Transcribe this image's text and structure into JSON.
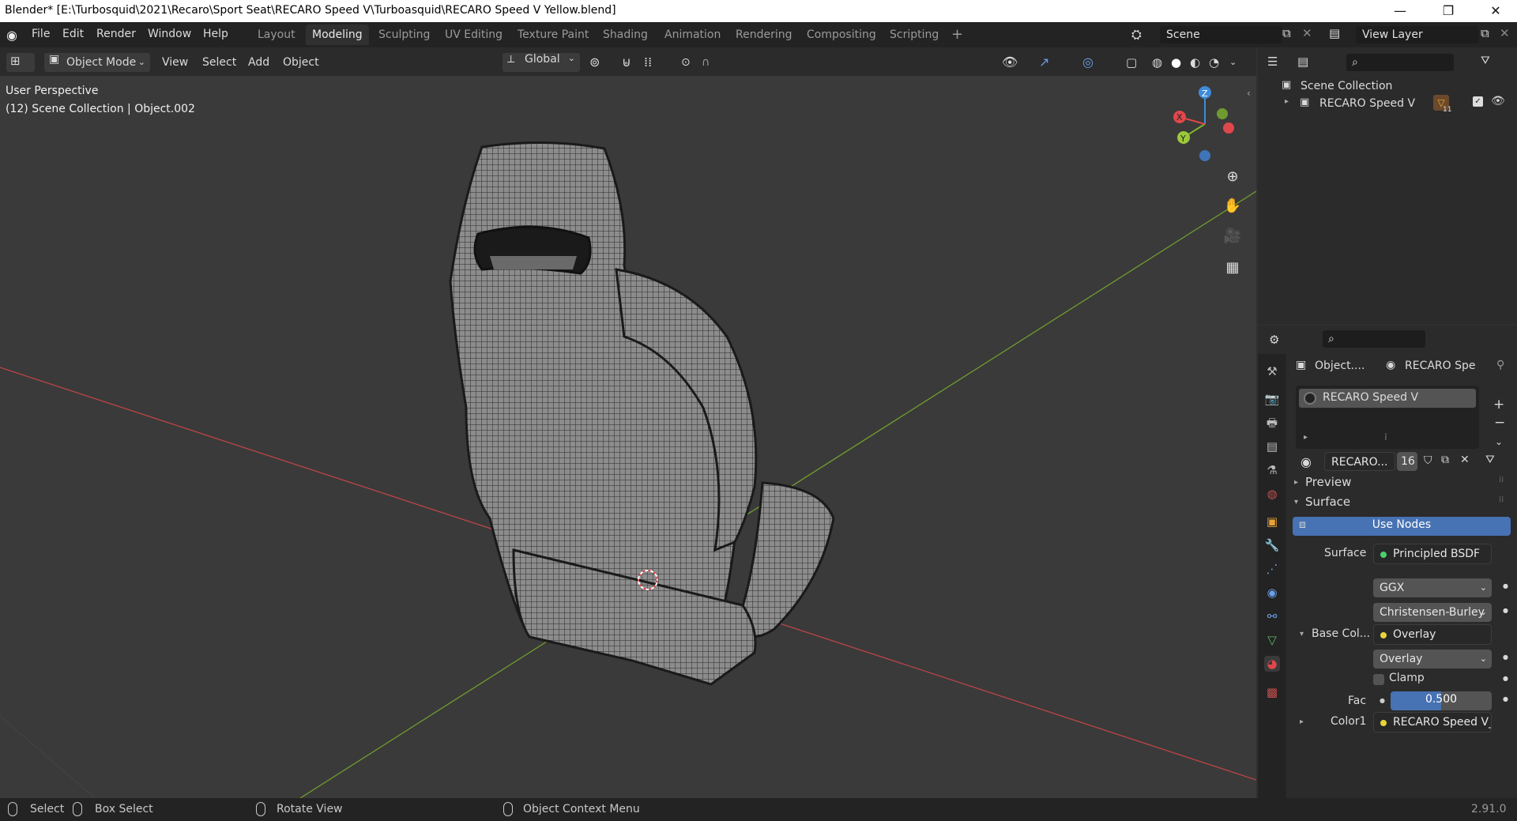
{
  "window": {
    "title": "Blender* [E:\\Turbosquid\\2021\\Recaro\\Sport Seat\\RECARO Speed V\\Turboasquid\\RECARO Speed V Yellow.blend]",
    "minimize": "—",
    "maximize": "❐",
    "close": "✕"
  },
  "menu": [
    "File",
    "Edit",
    "Render",
    "Window",
    "Help"
  ],
  "workspaces": [
    "Layout",
    "Modeling",
    "Sculpting",
    "UV Editing",
    "Texture Paint",
    "Shading",
    "Animation",
    "Rendering",
    "Compositing",
    "Scripting"
  ],
  "active_workspace": "Modeling",
  "add_workspace": "+",
  "scene": {
    "name": "Scene",
    "view_layer": "View Layer"
  },
  "viewport_header": {
    "mode": "Object Mode",
    "menus": [
      "View",
      "Select",
      "Add",
      "Object"
    ],
    "orientation": "Global"
  },
  "viewport": {
    "perspective": "User Perspective",
    "collection_info": "(12) Scene Collection | Object.002",
    "gizmo": {
      "x": "X",
      "y": "Y",
      "z": "Z"
    },
    "colors": {
      "x_axis": "#e0474b",
      "y_axis": "#7fb52a",
      "z_axis": "#3f8bd8",
      "background": "#3a3a3a"
    }
  },
  "outliner": {
    "root": "Scene Collection",
    "items": [
      {
        "label": "RECARO Speed V",
        "count": "11"
      }
    ]
  },
  "properties": {
    "breadcrumb_object": "Object....",
    "breadcrumb_material": "RECARO Spe",
    "material_slot": "RECARO Speed V",
    "material_name": "RECARO...",
    "users": "16",
    "sections": {
      "preview": "Preview",
      "surface": "Surface"
    },
    "use_nodes": "Use Nodes",
    "surface_label": "Surface",
    "surface_shader": "Principled BSDF",
    "distribution": "GGX",
    "subsurface": "Christensen-Burley",
    "base_color_label": "Base Col...",
    "base_color_node": "Overlay",
    "blend_mode": "Overlay",
    "clamp": "Clamp",
    "fac_label": "Fac",
    "fac_value": "0.500",
    "fac": 0.5,
    "color1_label": "Color1",
    "color1_value": "RECARO Speed V_...",
    "accent": "#4772b3"
  },
  "status": {
    "select": "Select",
    "box_select": "Box Select",
    "rotate": "Rotate View",
    "context": "Object Context Menu",
    "version": "2.91.0"
  }
}
